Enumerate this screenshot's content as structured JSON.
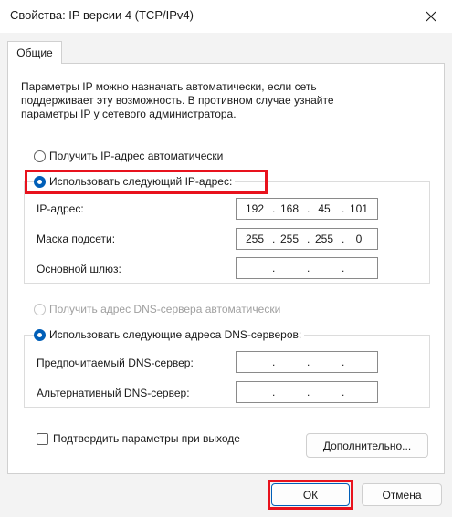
{
  "window": {
    "title": "Свойства: IP версии 4 (TCP/IPv4)",
    "close_icon": "close-icon"
  },
  "tabs": [
    {
      "label": "Общие",
      "active": true
    }
  ],
  "description": "Параметры IP можно назначать автоматически, если сеть\nподдерживает эту возможность. В противном случае узнайте\nпараметры IP у сетевого администратора.",
  "ip_mode": {
    "auto_label": "Получить IP-адрес автоматически",
    "manual_label": "Использовать следующий IP-адрес:",
    "selected": "manual"
  },
  "ip_settings": {
    "ip_label": "IP-адрес:",
    "ip_value": [
      "192",
      "168",
      "45",
      "101"
    ],
    "mask_label": "Маска подсети:",
    "mask_value": [
      "255",
      "255",
      "255",
      "0"
    ],
    "gateway_label": "Основной шлюз:",
    "gateway_value": [
      "",
      "",
      "",
      ""
    ]
  },
  "dns_mode": {
    "auto_label": "Получить адрес DNS-сервера автоматически",
    "manual_label": "Использовать следующие адреса DNS-серверов:",
    "selected": "manual",
    "auto_disabled": true
  },
  "dns_settings": {
    "preferred_label": "Предпочитаемый DNS-сервер:",
    "preferred_value": [
      "",
      "",
      "",
      ""
    ],
    "alternate_label": "Альтернативный DNS-сервер:",
    "alternate_value": [
      "",
      "",
      "",
      ""
    ]
  },
  "validate_on_exit": {
    "label": "Подтвердить параметры при выходе",
    "checked": false
  },
  "buttons": {
    "advanced": "Дополнительно...",
    "ok": "ОК",
    "cancel": "Отмена"
  },
  "colors": {
    "accent": "#005fb8",
    "highlight": "#e8121d"
  }
}
